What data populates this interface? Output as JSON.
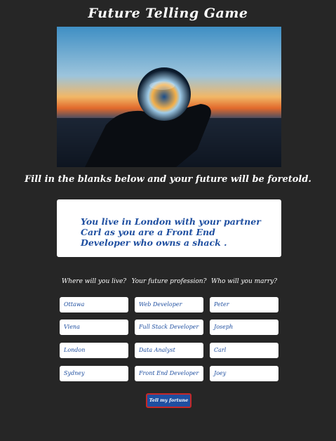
{
  "page": {
    "title": "Future Telling Game",
    "hero_image": "crystal-ball-photo",
    "instruction": "Fill in the blanks below and your future will be foretold.",
    "fortune": "You live in London with your partner Carl as you are a Front End Developer who owns a shack ."
  },
  "columns": [
    {
      "header": "Where will you live?",
      "values": [
        "Ottawa",
        "Viena",
        "London",
        "Sydney"
      ]
    },
    {
      "header": "Your future profession?",
      "values": [
        "Web Developer",
        "Full Stack Developer",
        "Data Analyst",
        "Front End Developer"
      ]
    },
    {
      "header": "Who will you marry?",
      "values": [
        "Peter",
        "Joseph",
        "Carl",
        "Joey"
      ]
    }
  ],
  "button": {
    "label": "Tell my fortune"
  },
  "colors": {
    "background": "#262626",
    "accent": "#1f4fa0",
    "button_border": "#c62828"
  }
}
